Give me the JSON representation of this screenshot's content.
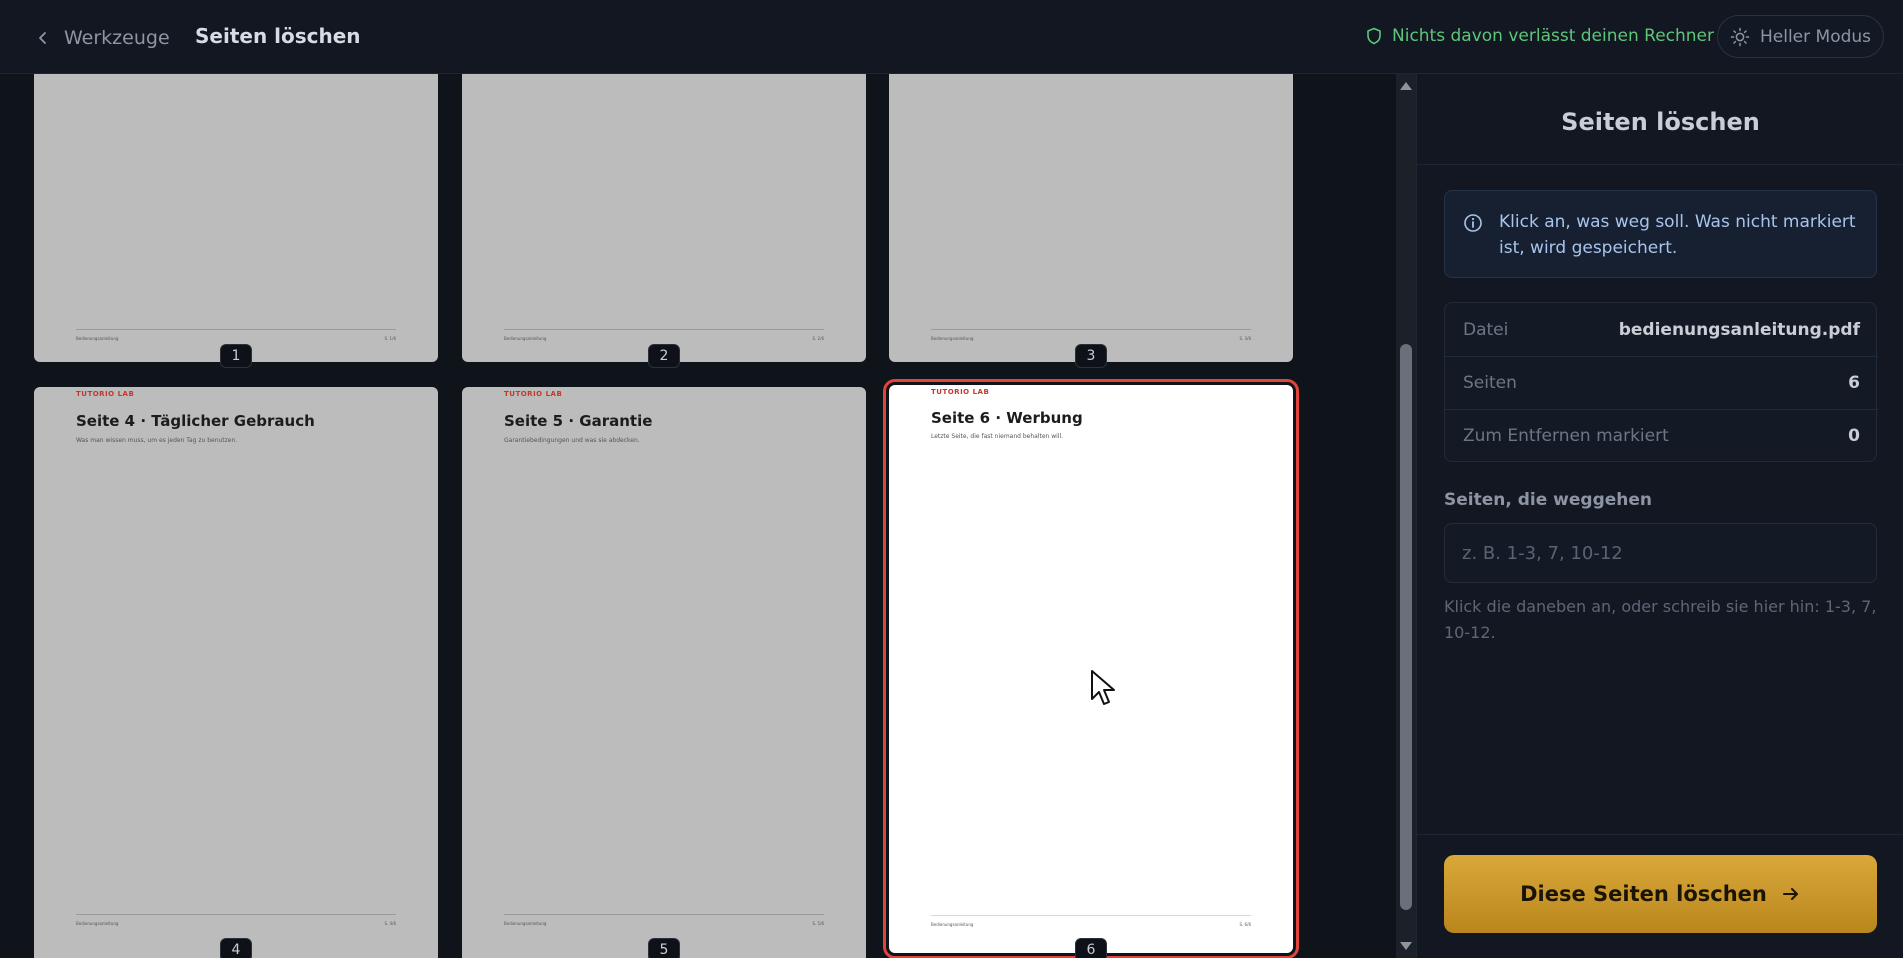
{
  "header": {
    "back_label": "Werkzeuge",
    "title": "Seiten löschen",
    "privacy_text": "Nichts davon verlässt deinen Rechner",
    "theme_label": "Heller Modus",
    "privacy_color": "#5dc67a"
  },
  "pages": [
    {
      "number": "1",
      "brand": "",
      "title": "",
      "subtitle": "",
      "footer_left": "Bedienungsanleitung",
      "footer_right": "S. 1/6",
      "selected": false
    },
    {
      "number": "2",
      "brand": "",
      "title": "",
      "subtitle": "",
      "footer_left": "Bedienungsanleitung",
      "footer_right": "S. 2/6",
      "selected": false
    },
    {
      "number": "3",
      "brand": "",
      "title": "",
      "subtitle": "",
      "footer_left": "Bedienungsanleitung",
      "footer_right": "S. 3/6",
      "selected": false
    },
    {
      "number": "4",
      "brand": "TUTORIO LAB",
      "title": "Seite 4 · Täglicher Gebrauch",
      "subtitle": "Was man wissen muss, um es jeden Tag zu benutzen.",
      "footer_left": "Bedienungsanleitung",
      "footer_right": "S. 4/6",
      "selected": false
    },
    {
      "number": "5",
      "brand": "TUTORIO LAB",
      "title": "Seite 5 · Garantie",
      "subtitle": "Garantiebedingungen und was sie abdecken.",
      "footer_left": "Bedienungsanleitung",
      "footer_right": "S. 5/6",
      "selected": false
    },
    {
      "number": "6",
      "brand": "TUTORIO LAB",
      "title": "Seite 6 · Werbung",
      "subtitle": "Letzte Seite, die fast niemand behalten will.",
      "footer_left": "Bedienungsanleitung",
      "footer_right": "S. 6/6",
      "selected": true
    }
  ],
  "panel": {
    "title": "Seiten löschen",
    "info_text": "Klick an, was weg soll. Was nicht markiert ist, wird gespeichert.",
    "stats": [
      {
        "key": "Datei",
        "value": "bedienungsanleitung.pdf"
      },
      {
        "key": "Seiten",
        "value": "6"
      },
      {
        "key": "Zum Entfernen markiert",
        "value": "0"
      }
    ],
    "field_label": "Seiten, die weggehen",
    "field_placeholder": "z. B. 1-3, 7, 10-12",
    "field_value": "",
    "hint": "Klick die daneben an, oder schreib sie hier hin: 1-3, 7, 10-12.",
    "cta_label": "Diese Seiten löschen",
    "cta_color": "#c9961f",
    "selection_color": "#e0443a"
  },
  "icons": {
    "back": "chevron-left-icon",
    "privacy": "shield-icon",
    "theme": "sun-icon",
    "info": "info-icon",
    "cta": "arrow-right-icon"
  }
}
